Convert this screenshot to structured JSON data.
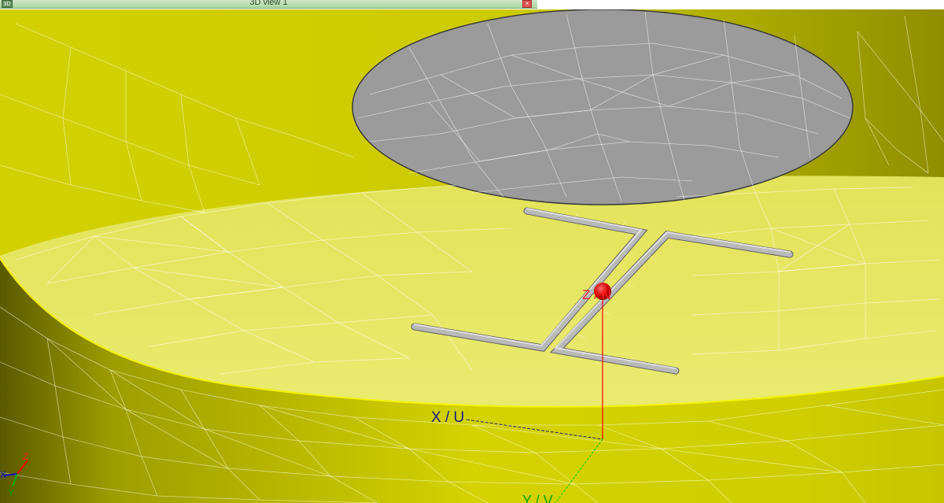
{
  "window": {
    "title": "3D view 1",
    "app_icon_label": "3D",
    "close_glyph": "×"
  },
  "axes": {
    "x_label": "X / U",
    "z_label": "Z / N",
    "y_label": "Y / V",
    "triad_x": "X",
    "triad_y": "Y",
    "triad_z": "Z"
  },
  "colors": {
    "cylinder_side": "#c9c800",
    "cylinder_top": "#e6e660",
    "disk": "#9a9a9a",
    "dipole": "#b8b8b8",
    "origin_marker": "#d40000",
    "mesh": "#ffffff"
  }
}
